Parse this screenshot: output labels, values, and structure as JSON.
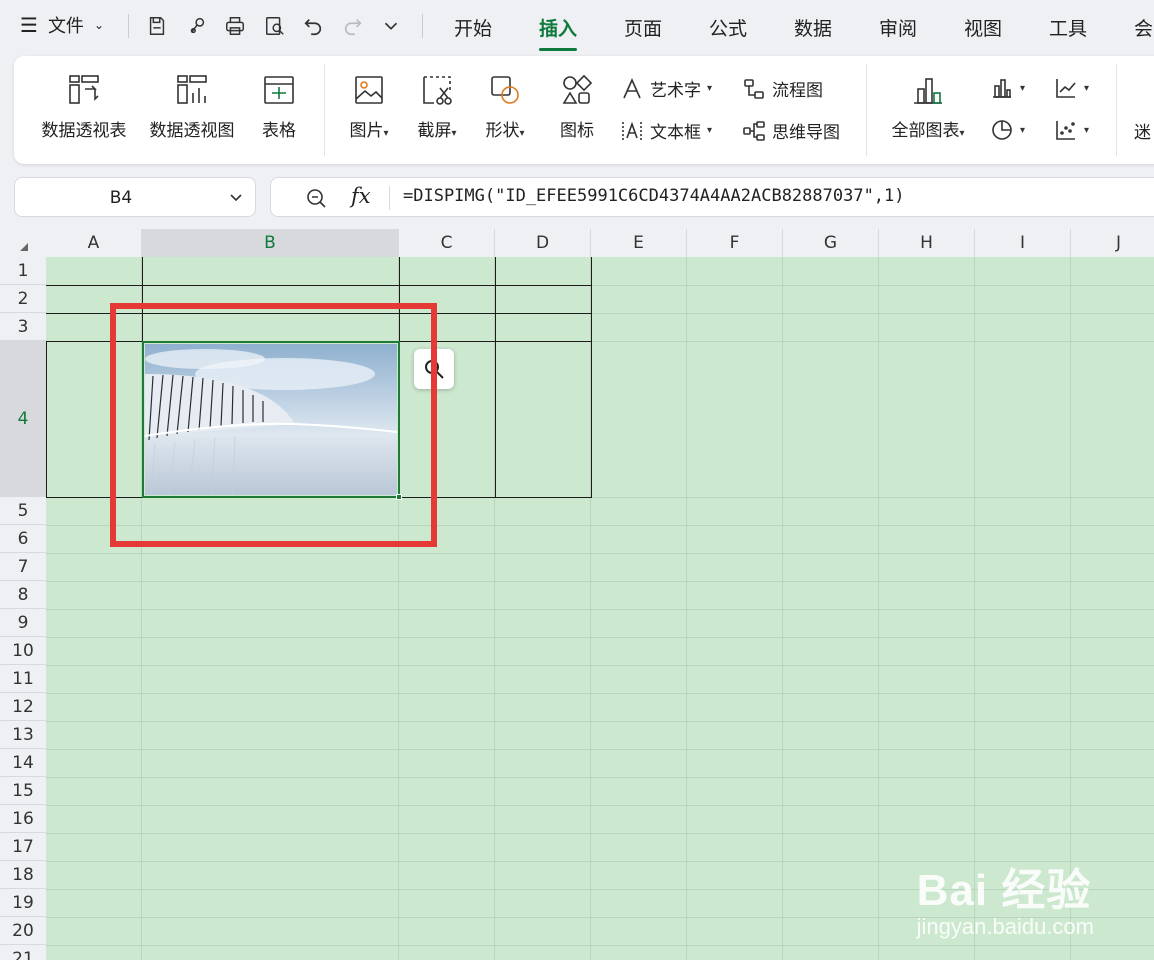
{
  "menubar": {
    "file_label": "文件",
    "tabs": [
      "开始",
      "插入",
      "页面",
      "公式",
      "数据",
      "审阅",
      "视图",
      "工具",
      "会"
    ],
    "active_tab": "插入"
  },
  "ribbon": {
    "pivot_table": "数据透视表",
    "pivot_chart": "数据透视图",
    "table": "表格",
    "picture": "图片",
    "screenshot": "截屏",
    "shape": "形状",
    "icon": "图标",
    "wordart": "艺术字",
    "textbox": "文本框",
    "flowchart": "流程图",
    "mindmap": "思维导图",
    "all_charts": "全部图表",
    "sparkline": "迷"
  },
  "formula_bar": {
    "cell_ref": "B4",
    "formula": "=DISPIMG(\"ID_EFEE5991C6CD4374A4AA2ACB82887037\",1)"
  },
  "sheet": {
    "columns": [
      "A",
      "B",
      "C",
      "D",
      "E",
      "F",
      "G",
      "H",
      "I",
      "J"
    ],
    "rows": [
      "1",
      "2",
      "3",
      "4",
      "5",
      "6",
      "7",
      "8",
      "9",
      "10",
      "11",
      "12",
      "13",
      "14",
      "15",
      "16",
      "17",
      "18",
      "19",
      "20",
      "21"
    ],
    "selected_cell": "B4"
  },
  "watermark": {
    "main": "Bai 经验",
    "sub": "jingyan.baidu.com"
  }
}
